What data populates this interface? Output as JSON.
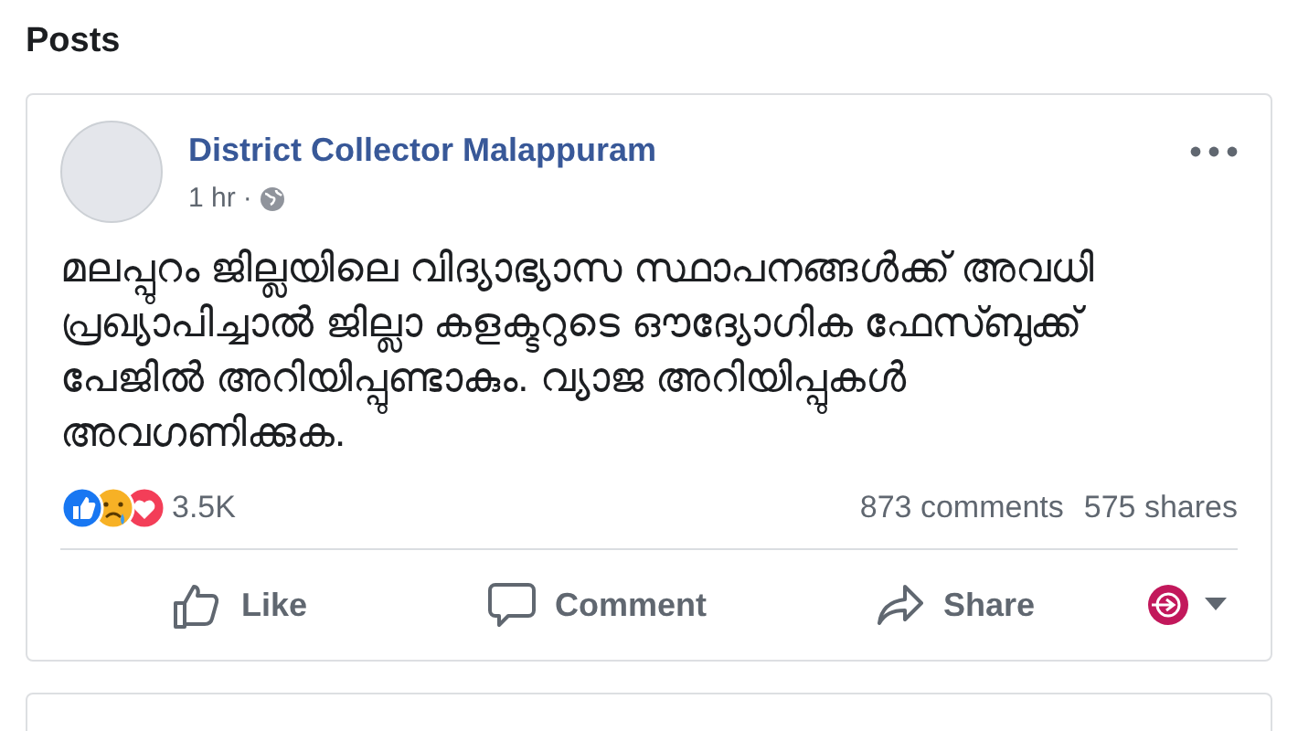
{
  "heading": "Posts",
  "post": {
    "author": "District Collector Malappuram",
    "time": "1 hr",
    "separator": "·",
    "text": "മലപ്പുറം ജില്ലയിലെ വിദ്യാഭ്യാസ സ്ഥാപനങ്ങൾക്ക് അവധി പ്രഖ്യാപിച്ചാൽ ജില്ലാ കളക്ടറുടെ ഔദ്യോഗിക ഫേസ്ബുക്ക് പേജിൽ അറിയിപ്പുണ്ടാകും. വ്യാജ അറിയിപ്പുകൾ അവഗണിക്കുക.",
    "reactions_count": "3.5K",
    "comments": "873 comments",
    "shares": "575 shares",
    "actions": [
      {
        "kind": "like",
        "label": "Like"
      },
      {
        "kind": "comment",
        "label": "Comment"
      },
      {
        "kind": "share",
        "label": "Share"
      }
    ]
  }
}
